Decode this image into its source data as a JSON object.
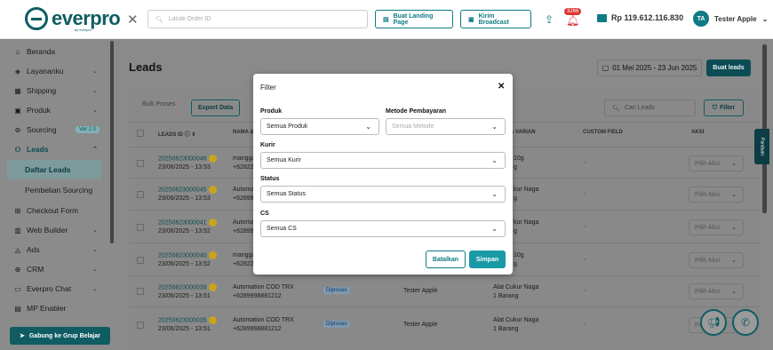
{
  "brand": {
    "name": "everpro",
    "sub": "by everpro"
  },
  "topbar": {
    "search_placeholder": "Lacak Order ID",
    "landing_btn": "Buat Landing Page",
    "broadcast_btn": "Kirim Broadcast",
    "notif_count": "3266",
    "balance": "Rp 119.612.116.830",
    "user_initials": "TA",
    "user_name": "Tester Apple"
  },
  "sidebar": {
    "items": [
      {
        "label": "Beranda",
        "icon": "home-icon"
      },
      {
        "label": "Layananku",
        "icon": "tag-icon"
      },
      {
        "label": "Shipping",
        "icon": "shipping-icon"
      },
      {
        "label": "Produk",
        "icon": "box-icon"
      },
      {
        "label": "Sourcing",
        "icon": "sourcing-icon",
        "badge": "Ver 2.0"
      },
      {
        "label": "Leads",
        "icon": "users-icon"
      },
      {
        "label": "Daftar Leads"
      },
      {
        "label": "Pembelian Sourcing"
      },
      {
        "label": "Checkout Form",
        "icon": "form-icon"
      },
      {
        "label": "Web Builder",
        "icon": "web-icon"
      },
      {
        "label": "Ads",
        "icon": "ads-icon"
      },
      {
        "label": "CRM",
        "icon": "crm-icon"
      },
      {
        "label": "Everpro Chat",
        "icon": "chat-icon"
      },
      {
        "label": "MP Enabler",
        "icon": "mp-icon"
      }
    ],
    "join_btn": "Gabung ke Grup Belajar"
  },
  "main": {
    "title": "Leads",
    "date_range": "01 Mei 2025 - 23 Jun 2025",
    "create_btn": "Buat leads",
    "bulk": "Bulk Proses",
    "export": "Export Data",
    "search_placeholder": "Cari Leads",
    "filter_btn": "Filter",
    "columns": [
      "LEADS ID",
      "NAMA &",
      "& VARIAN",
      "CUSTOM FIELD",
      "AKSI"
    ],
    "aksi_label": "Pilih Aksi",
    "rows": [
      {
        "id": "20250623000046",
        "date": "23/06/2025 - 13:53",
        "name": "mangga",
        "phone": "+62822",
        "product": "10g",
        "qty": "g"
      },
      {
        "id": "20250623000045",
        "date": "23/06/2025 - 13:53",
        "name": "Automa",
        "phone": "+62899",
        "product": "kur Naga",
        "qty": "g"
      },
      {
        "id": "20250623000041",
        "date": "23/06/2025 - 13:52",
        "name": "Automa",
        "phone": "+62899",
        "product": "kur Naga",
        "qty": "g"
      },
      {
        "id": "20250623000040",
        "date": "23/06/2025 - 13:52",
        "name": "mangga",
        "phone": "+62822",
        "product": "10g",
        "qty": "g"
      },
      {
        "id": "20250623000039",
        "date": "23/06/2025 - 13:51",
        "name": "Automation COD TRX",
        "phone": "+6289998881212",
        "status": "Diproses",
        "cs": "Tester Apple",
        "product": "Alat Cukur Naga",
        "qty": "1 Barang"
      },
      {
        "id": "20250623000035",
        "date": "23/06/2025 - 13:51",
        "name": "Automation COD TRX",
        "phone": "+6289998881212",
        "status": "Diproses",
        "cs": "Tester Apple",
        "product": "Alat Cukur Naga",
        "qty": "1 Barang"
      }
    ],
    "dash": "-",
    "panduan": "Panduan"
  },
  "modal": {
    "title": "Filter",
    "produk_label": "Produk",
    "produk_value": "Semua Produk",
    "metode_label": "Metode Pembayaran",
    "metode_placeholder": "Semua Metode",
    "kurir_label": "Kurir",
    "kurir_value": "Semua Kurir",
    "status_label": "Status",
    "status_value": "Semua Status",
    "cs_label": "CS",
    "cs_value": "Semua CS",
    "cancel": "Batalkan",
    "save": "Simpan"
  }
}
